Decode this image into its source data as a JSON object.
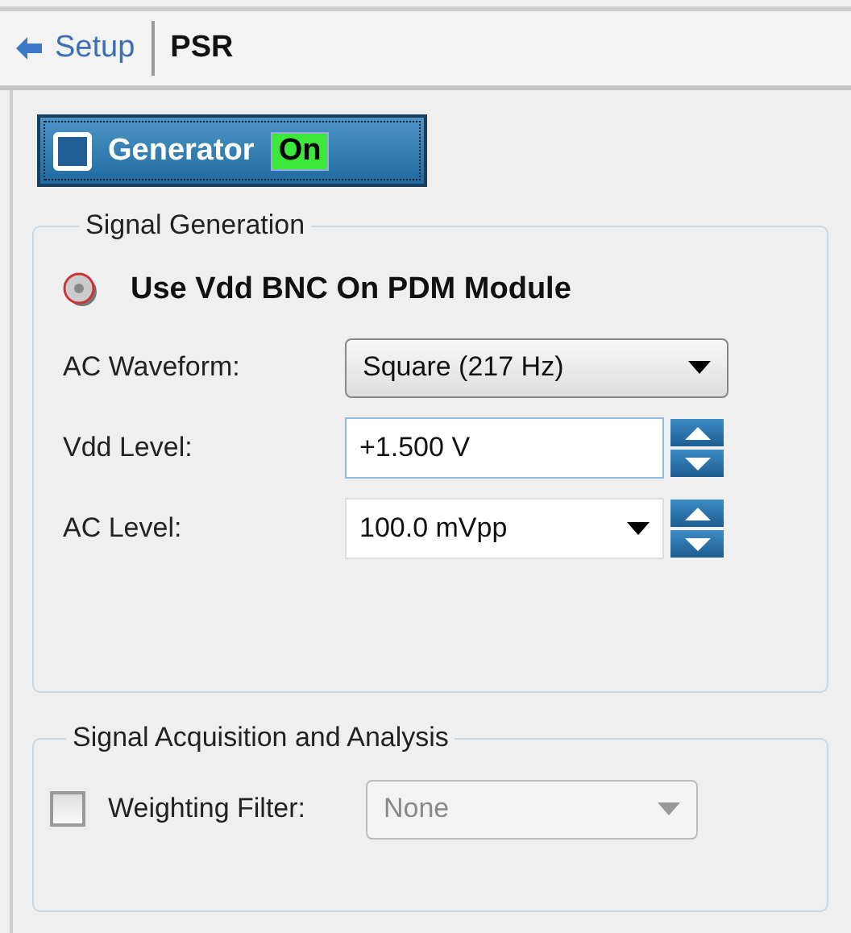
{
  "breadcrumb": {
    "back": "Setup",
    "current": "PSR"
  },
  "generator": {
    "label": "Generator",
    "on": true,
    "state_text": "On"
  },
  "signal_generation": {
    "title": "Signal Generation",
    "heading": "Use Vdd BNC On PDM Module",
    "fields": [
      {
        "kind": "dropdown",
        "label": "AC Waveform:",
        "value": "Square (217 Hz)"
      },
      {
        "kind": "spin",
        "label": "Vdd Level:",
        "value": "+1.500 V"
      },
      {
        "kind": "spin-dropdown",
        "label": "AC Level:",
        "value": "100.0 mVpp"
      }
    ]
  },
  "signal_acquisition": {
    "title": "Signal Acquisition and Analysis",
    "weighting": {
      "label": "Weighting Filter:",
      "checked": false,
      "value": "None",
      "disabled": true
    }
  }
}
